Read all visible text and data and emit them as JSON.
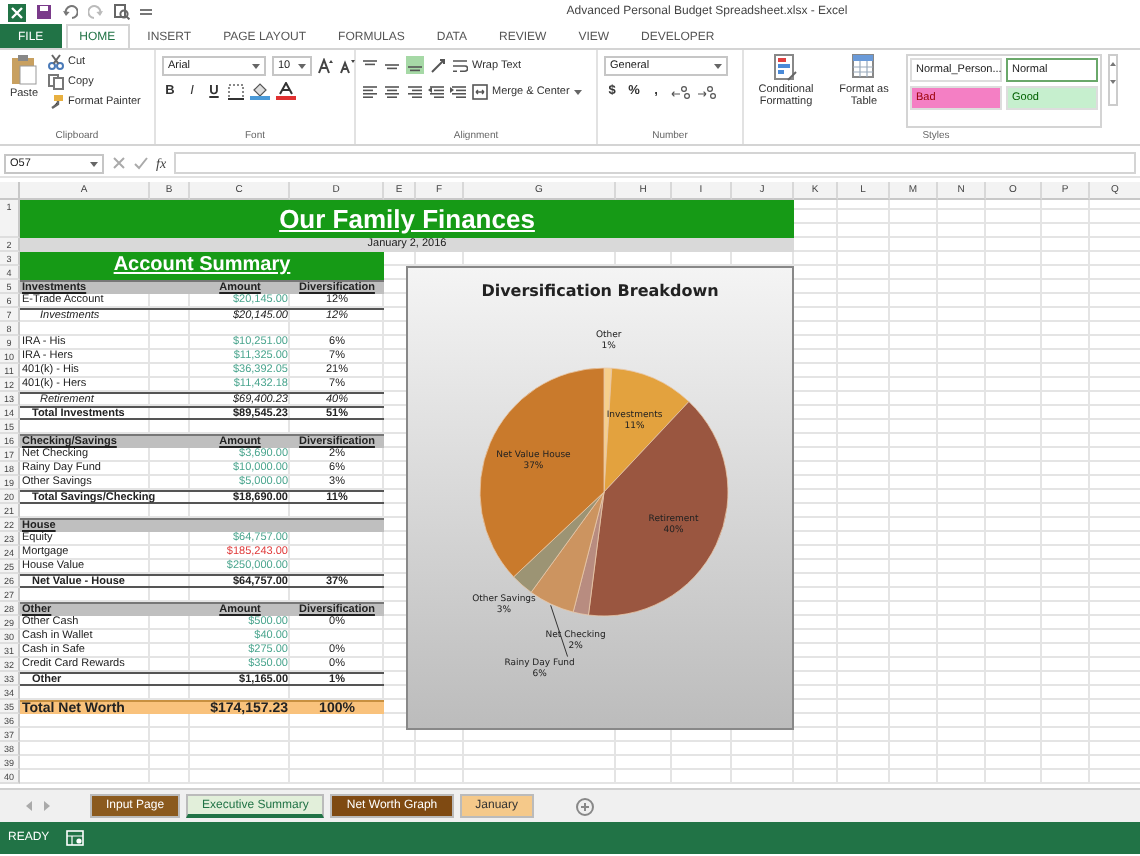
{
  "window": {
    "title": "Advanced Personal Budget Spreadsheet.xlsx - Excel"
  },
  "ribbon_tabs": [
    {
      "label": "FILE",
      "kind": "file",
      "selected": false
    },
    {
      "label": "HOME",
      "kind": "tab",
      "selected": true
    },
    {
      "label": "INSERT",
      "kind": "tab",
      "selected": false
    },
    {
      "label": "PAGE LAYOUT",
      "kind": "tab",
      "selected": false
    },
    {
      "label": "FORMULAS",
      "kind": "tab",
      "selected": false
    },
    {
      "label": "DATA",
      "kind": "tab",
      "selected": false
    },
    {
      "label": "REVIEW",
      "kind": "tab",
      "selected": false
    },
    {
      "label": "VIEW",
      "kind": "tab",
      "selected": false
    },
    {
      "label": "DEVELOPER",
      "kind": "tab",
      "selected": false
    }
  ],
  "ribbon": {
    "clipboard": {
      "paste": "Paste",
      "cut": "Cut",
      "copy": "Copy",
      "format_painter": "Format Painter",
      "label": "Clipboard"
    },
    "font": {
      "name": "Arial",
      "size": "10",
      "bold": "B",
      "italic": "I",
      "underline": "U",
      "label": "Font"
    },
    "alignment": {
      "wrap_text": "Wrap Text",
      "merge_center": "Merge & Center",
      "label": "Alignment"
    },
    "number": {
      "format": "General",
      "currency": "$",
      "percent": "%",
      "comma": ",",
      "label": "Number"
    },
    "styles": {
      "conditional_formatting": "Conditional Formatting",
      "format_as_table": "Format as Table",
      "label": "Styles",
      "gallery": [
        {
          "label": "Normal_Person...",
          "color": "#ffffff",
          "selected": false
        },
        {
          "label": "Normal",
          "color": "#ffffff",
          "selected": true
        },
        {
          "label": "Bad",
          "color": "#f47fc4",
          "selected": false
        },
        {
          "label": "Good",
          "color": "#c6efce",
          "selected": false
        }
      ]
    }
  },
  "formula_bar": {
    "name_box": "O57",
    "function_label": "fx"
  },
  "columns": [
    "A",
    "B",
    "C",
    "D",
    "E",
    "F",
    "G",
    "H",
    "I",
    "J",
    "K",
    "L",
    "M",
    "N",
    "O",
    "P",
    "Q"
  ],
  "row_numbers": [
    "1",
    "2",
    "3",
    "4",
    "5",
    "6",
    "7",
    "8",
    "9",
    "10",
    "11",
    "12",
    "13",
    "14",
    "15",
    "16",
    "17",
    "18",
    "19",
    "20",
    "21",
    "22",
    "23",
    "24",
    "25",
    "26",
    "27",
    "28",
    "29",
    "30",
    "31",
    "32",
    "33",
    "34",
    "35",
    "36",
    "37",
    "38",
    "39",
    "40"
  ],
  "sheet": {
    "title": "Our Family Finances",
    "date": "January 2, 2016",
    "summary_title": "Account Summary",
    "sections": [
      {
        "header": {
          "label": "Investments",
          "amount": "Amount",
          "share": "Diversification"
        },
        "rows": [
          {
            "kind": "item",
            "label": "E-Trade Account",
            "amount": "$20,145.00",
            "share": "12%"
          },
          {
            "kind": "subtotal",
            "label": "Investments",
            "amount": "$20,145.00",
            "share": "12%"
          },
          {
            "kind": "spacer"
          },
          {
            "kind": "item",
            "label": "IRA - His",
            "amount": "$10,251.00",
            "share": "6%"
          },
          {
            "kind": "item",
            "label": "IRA - Hers",
            "amount": "$11,325.00",
            "share": "7%"
          },
          {
            "kind": "item",
            "label": "401(k) - His",
            "amount": "$36,392.05",
            "share": "21%"
          },
          {
            "kind": "item",
            "label": "401(k) - Hers",
            "amount": "$11,432.18",
            "share": "7%"
          },
          {
            "kind": "subtotal",
            "label": "Retirement",
            "amount": "$69,400.23",
            "share": "40%"
          },
          {
            "kind": "total",
            "label": "Total Investments",
            "amount": "$89,545.23",
            "share": "51%"
          }
        ]
      },
      {
        "header": {
          "label": "Checking/Savings",
          "amount": "Amount",
          "share": "Diversification"
        },
        "rows": [
          {
            "kind": "item",
            "label": "Net Checking",
            "amount": "$3,690.00",
            "share": "2%"
          },
          {
            "kind": "item",
            "label": "Rainy Day Fund",
            "amount": "$10,000.00",
            "share": "6%"
          },
          {
            "kind": "item",
            "label": "Other Savings",
            "amount": "$5,000.00",
            "share": "3%"
          },
          {
            "kind": "total",
            "label": "Total Savings/Checking",
            "amount": "$18,690.00",
            "share": "11%"
          }
        ]
      },
      {
        "header": {
          "label": "House"
        },
        "rows": [
          {
            "kind": "item",
            "label": "Equity",
            "amount": "$64,757.00"
          },
          {
            "kind": "debt",
            "label": "Mortgage",
            "amount": "$185,243.00"
          },
          {
            "kind": "item",
            "label": "House Value",
            "amount": "$250,000.00"
          },
          {
            "kind": "total",
            "label": "Net Value - House",
            "amount": "$64,757.00",
            "share": "37%"
          }
        ]
      },
      {
        "header": {
          "label": "Other",
          "amount": "Amount",
          "share": "Diversification"
        },
        "rows": [
          {
            "kind": "item",
            "label": "Other Cash",
            "amount": "$500.00",
            "share": "0%"
          },
          {
            "kind": "item",
            "label": "Cash in Wallet",
            "amount": "$40.00"
          },
          {
            "kind": "item",
            "label": "Cash in Safe",
            "amount": "$275.00",
            "share": "0%"
          },
          {
            "kind": "item",
            "label": "Credit Card Rewards",
            "amount": "$350.00",
            "share": "0%"
          },
          {
            "kind": "total",
            "label": "Other",
            "amount": "$1,165.00",
            "share": "1%"
          }
        ]
      }
    ],
    "net_worth": {
      "label": "Total Net Worth",
      "amount": "$174,157.23",
      "share": "100%"
    }
  },
  "chart": {
    "chart_data": {
      "type": "pie",
      "title": "Diversification Breakdown",
      "categories": [
        "Other",
        "Investments",
        "Retirement",
        "Net Checking",
        "Rainy Day Fund",
        "Other Savings",
        "Net Value House"
      ],
      "values": [
        1,
        11,
        40,
        2,
        6,
        3,
        37
      ],
      "data_labels": true,
      "value_labels": [
        "1%",
        "11%",
        "40%",
        "2%",
        "6%",
        "3%",
        "37%"
      ]
    }
  },
  "sheet_tabs": [
    {
      "label": "Input Page",
      "color": "#8b5a1e",
      "selected": false
    },
    {
      "label": "Executive Summary",
      "color": "#e2efda",
      "selected": true
    },
    {
      "label": "Net Worth Graph",
      "color": "#7f4a12",
      "selected": false
    },
    {
      "label": "January",
      "color": "#f5c98a",
      "selected": false
    }
  ],
  "status_bar": {
    "mode": "READY"
  }
}
